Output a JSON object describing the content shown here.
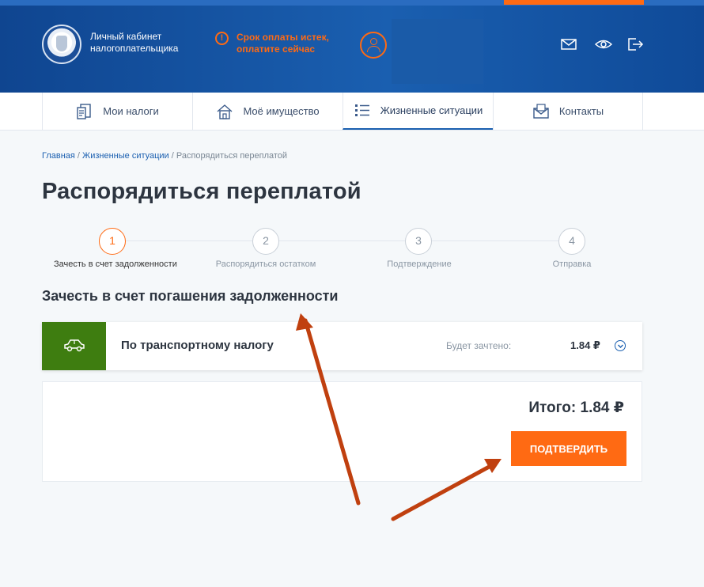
{
  "header": {
    "app_title": "Личный кабинет налогоплательщика",
    "warning": "Срок оплаты истек, оплатите сейчас"
  },
  "nav": {
    "items": [
      {
        "label": "Мои налоги",
        "icon": "tax-documents-icon"
      },
      {
        "label": "Моё имущество",
        "icon": "house-icon"
      },
      {
        "label": "Жизненные ситуации",
        "icon": "list-icon"
      },
      {
        "label": "Контакты",
        "icon": "envelope-icon"
      }
    ],
    "active_index": 2
  },
  "breadcrumb": {
    "home": "Главная",
    "sep": " / ",
    "section": "Жизненные ситуации",
    "current": "Распорядиться переплатой"
  },
  "page": {
    "title": "Распорядиться переплатой",
    "section_title": "Зачесть в счет погашения задолженности"
  },
  "stepper": {
    "steps": [
      {
        "num": "1",
        "label": "Зачесть в счет задолженности",
        "active": true
      },
      {
        "num": "2",
        "label": "Распорядиться остатком",
        "active": false
      },
      {
        "num": "3",
        "label": "Подтверждение",
        "active": false
      },
      {
        "num": "4",
        "label": "Отправка",
        "active": false
      }
    ]
  },
  "tax": {
    "name": "По транспортному налогу",
    "credited_label": "Будет зачтено:",
    "credited_value": "1.84 ₽",
    "icon": "car-icon",
    "icon_bg": "#3e7d10"
  },
  "summary": {
    "total": "Итого: 1.84 ₽",
    "confirm": "ПОДТВЕРДИТЬ"
  },
  "colors": {
    "accent": "#ff6a13",
    "brand": "#1a5fb0",
    "annotation_arrow": "#c0400f"
  }
}
